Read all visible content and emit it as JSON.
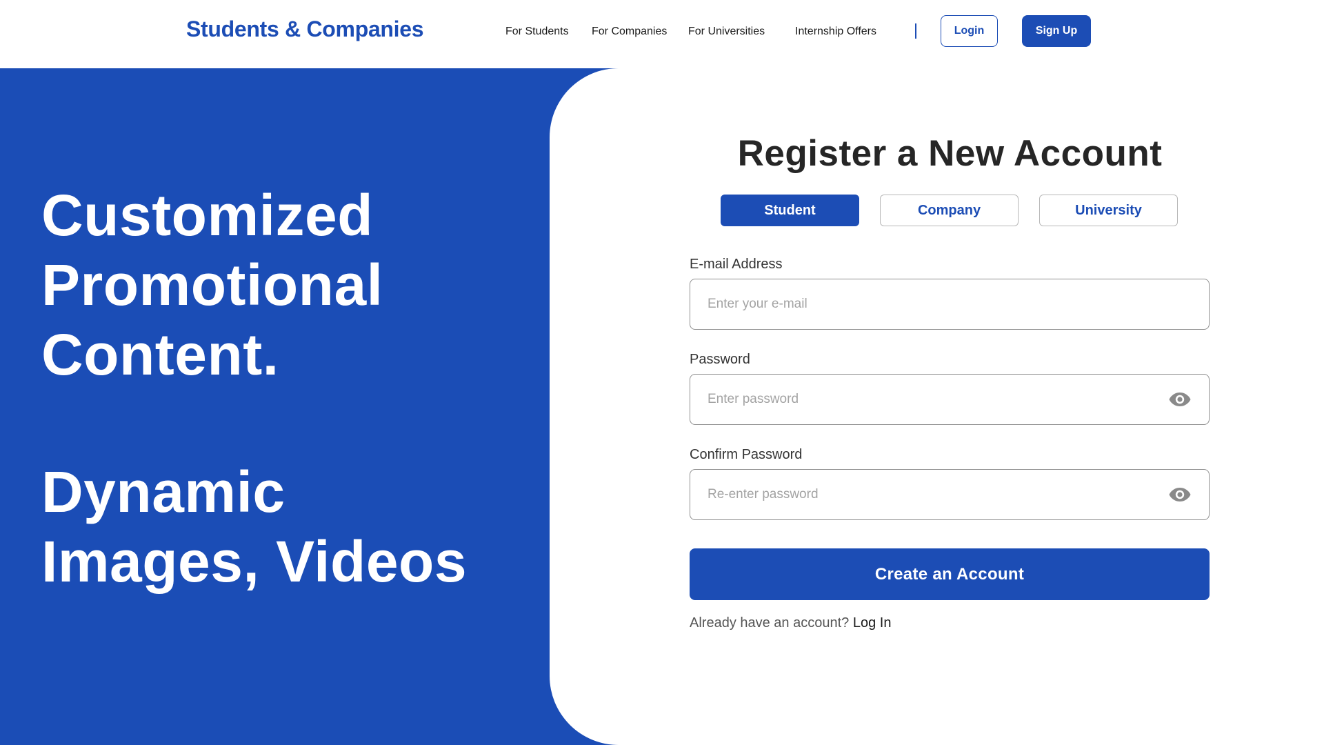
{
  "header": {
    "brand": "Students & Companies",
    "nav": [
      "For Students",
      "For Companies",
      "For Universities",
      "Internship Offers"
    ],
    "login_label": "Login",
    "signup_label": "Sign Up"
  },
  "hero": {
    "block1": [
      "Customized",
      "Promotional",
      "Content."
    ],
    "block2": [
      "Dynamic",
      "Images, Videos"
    ]
  },
  "form": {
    "title": "Register a New Account",
    "tabs": [
      {
        "label": "Student",
        "active": true
      },
      {
        "label": "Company",
        "active": false
      },
      {
        "label": "University",
        "active": false
      }
    ],
    "email": {
      "label": "E-mail Address",
      "placeholder": "Enter your e-mail",
      "value": ""
    },
    "password": {
      "label": "Password",
      "placeholder": "Enter password",
      "value": "",
      "icon": "eye-icon"
    },
    "confirm": {
      "label": "Confirm Password",
      "placeholder": "Re-enter password",
      "value": "",
      "icon": "eye-icon"
    },
    "submit_label": "Create an Account",
    "footer_text": "Already have an account?",
    "footer_link": "Log In"
  },
  "colors": {
    "primary": "#1c4db5",
    "hero_bg": "#1b4db6",
    "text_dark": "#262626",
    "border": "#8f8f8f",
    "icon_gray": "#8a8a8a"
  }
}
